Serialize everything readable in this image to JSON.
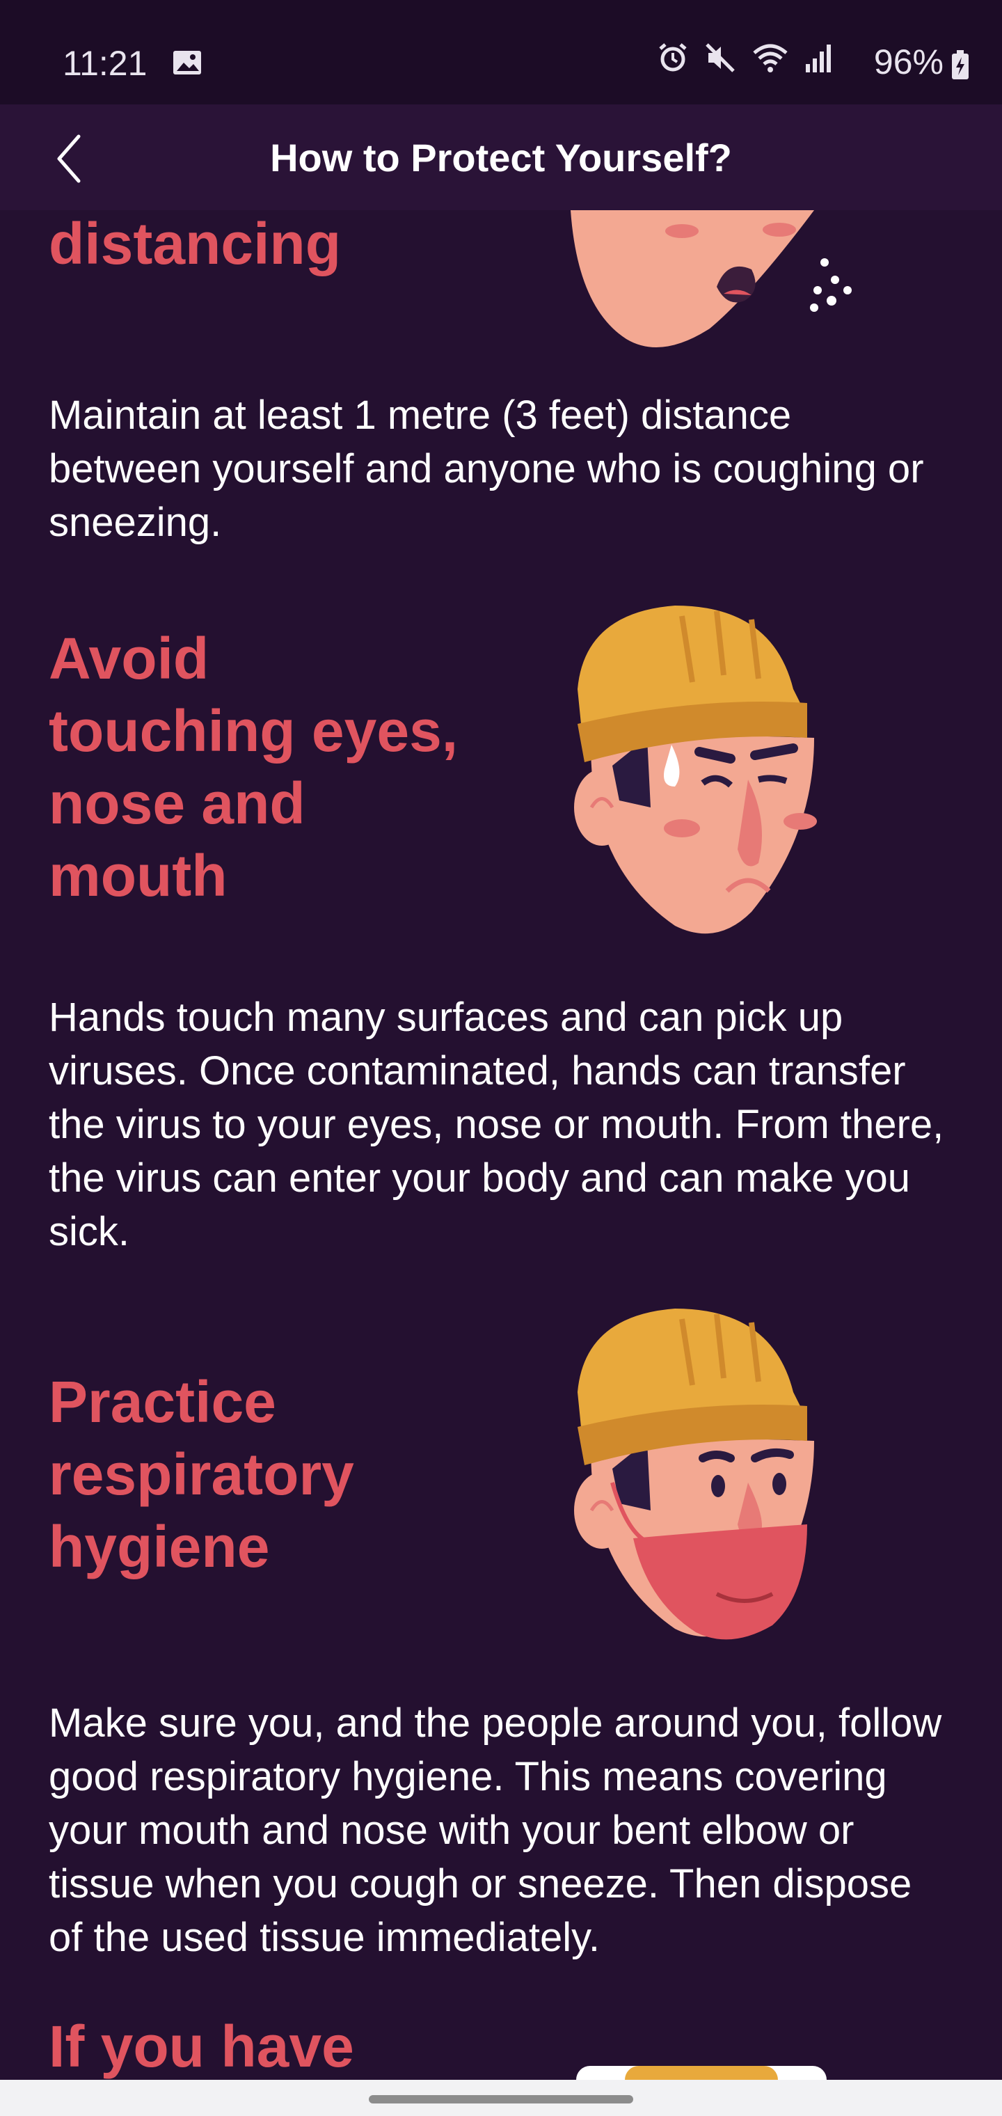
{
  "status_bar": {
    "time": "11:21",
    "battery": "96%",
    "icons": [
      "gallery-icon",
      "alarm-icon",
      "mute-icon",
      "wifi-icon",
      "signal-icon",
      "battery-charging-icon"
    ]
  },
  "app_bar": {
    "title": "How to Protect Yourself?",
    "back_icon": "chevron-left-icon"
  },
  "sections": [
    {
      "title": "distancing",
      "body": "Maintain at least 1 metre (3 feet) distance between yourself and anyone who is coughing or sneezing."
    },
    {
      "title_lines": [
        "Avoid",
        "touching eyes,",
        "nose and",
        "mouth"
      ],
      "body": "Hands touch many surfaces and can pick up viruses. Once contaminated, hands can transfer the virus to your eyes, nose or mouth. From there, the virus can enter your body and can make you sick."
    },
    {
      "title_lines": [
        "Practice",
        "respiratory",
        "hygiene"
      ],
      "body": "Make sure you, and the people around you, follow good respiratory hygiene. This means covering your mouth and nose with your bent elbow or tissue when you cough or sneeze. Then dispose of the used tissue immediately."
    },
    {
      "title": "If you have"
    }
  ],
  "colors": {
    "background": "#241030",
    "heading": "#e0545f",
    "text": "#ffffff",
    "hat": "#e8a93c",
    "skin": "#f3a892"
  }
}
